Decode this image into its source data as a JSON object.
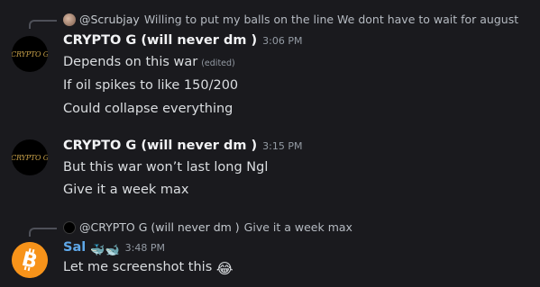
{
  "messages": [
    {
      "reply": {
        "author": "@Scrubjay",
        "text": "Willing to put my balls on the line   We dont have to wait for august"
      },
      "author": "CRYPTO G (will never dm )",
      "avatar_label": "CRYPTO G",
      "time": "3:06 PM",
      "lines": [
        {
          "text": "Depends on this war",
          "edited": "(edited)"
        },
        {
          "text": "If oil spikes to like 150/200"
        },
        {
          "text": "Could collapse everything"
        }
      ]
    },
    {
      "author": "CRYPTO G (will never dm )",
      "avatar_label": "CRYPTO G",
      "time": "3:15 PM",
      "lines": [
        {
          "text": "But this war won’t last long Ngl"
        },
        {
          "text": "Give it a week max"
        }
      ]
    },
    {
      "reply": {
        "author": "@CRYPTO G (will never dm )",
        "text": "Give it a week max"
      },
      "author": "Sal",
      "author_emojis": "🐳🐋",
      "avatar_icon": "bitcoin-icon",
      "time": "3:48 PM",
      "lines": [
        {
          "text": "Let me screenshot this",
          "emoji": "😂"
        }
      ]
    }
  ],
  "colors": {
    "background": "#1a1a1e",
    "username": "#f2f3f5",
    "sal_username": "#5fa8e9",
    "timestamp": "#949ba4",
    "bitcoin": "#f7931a"
  }
}
